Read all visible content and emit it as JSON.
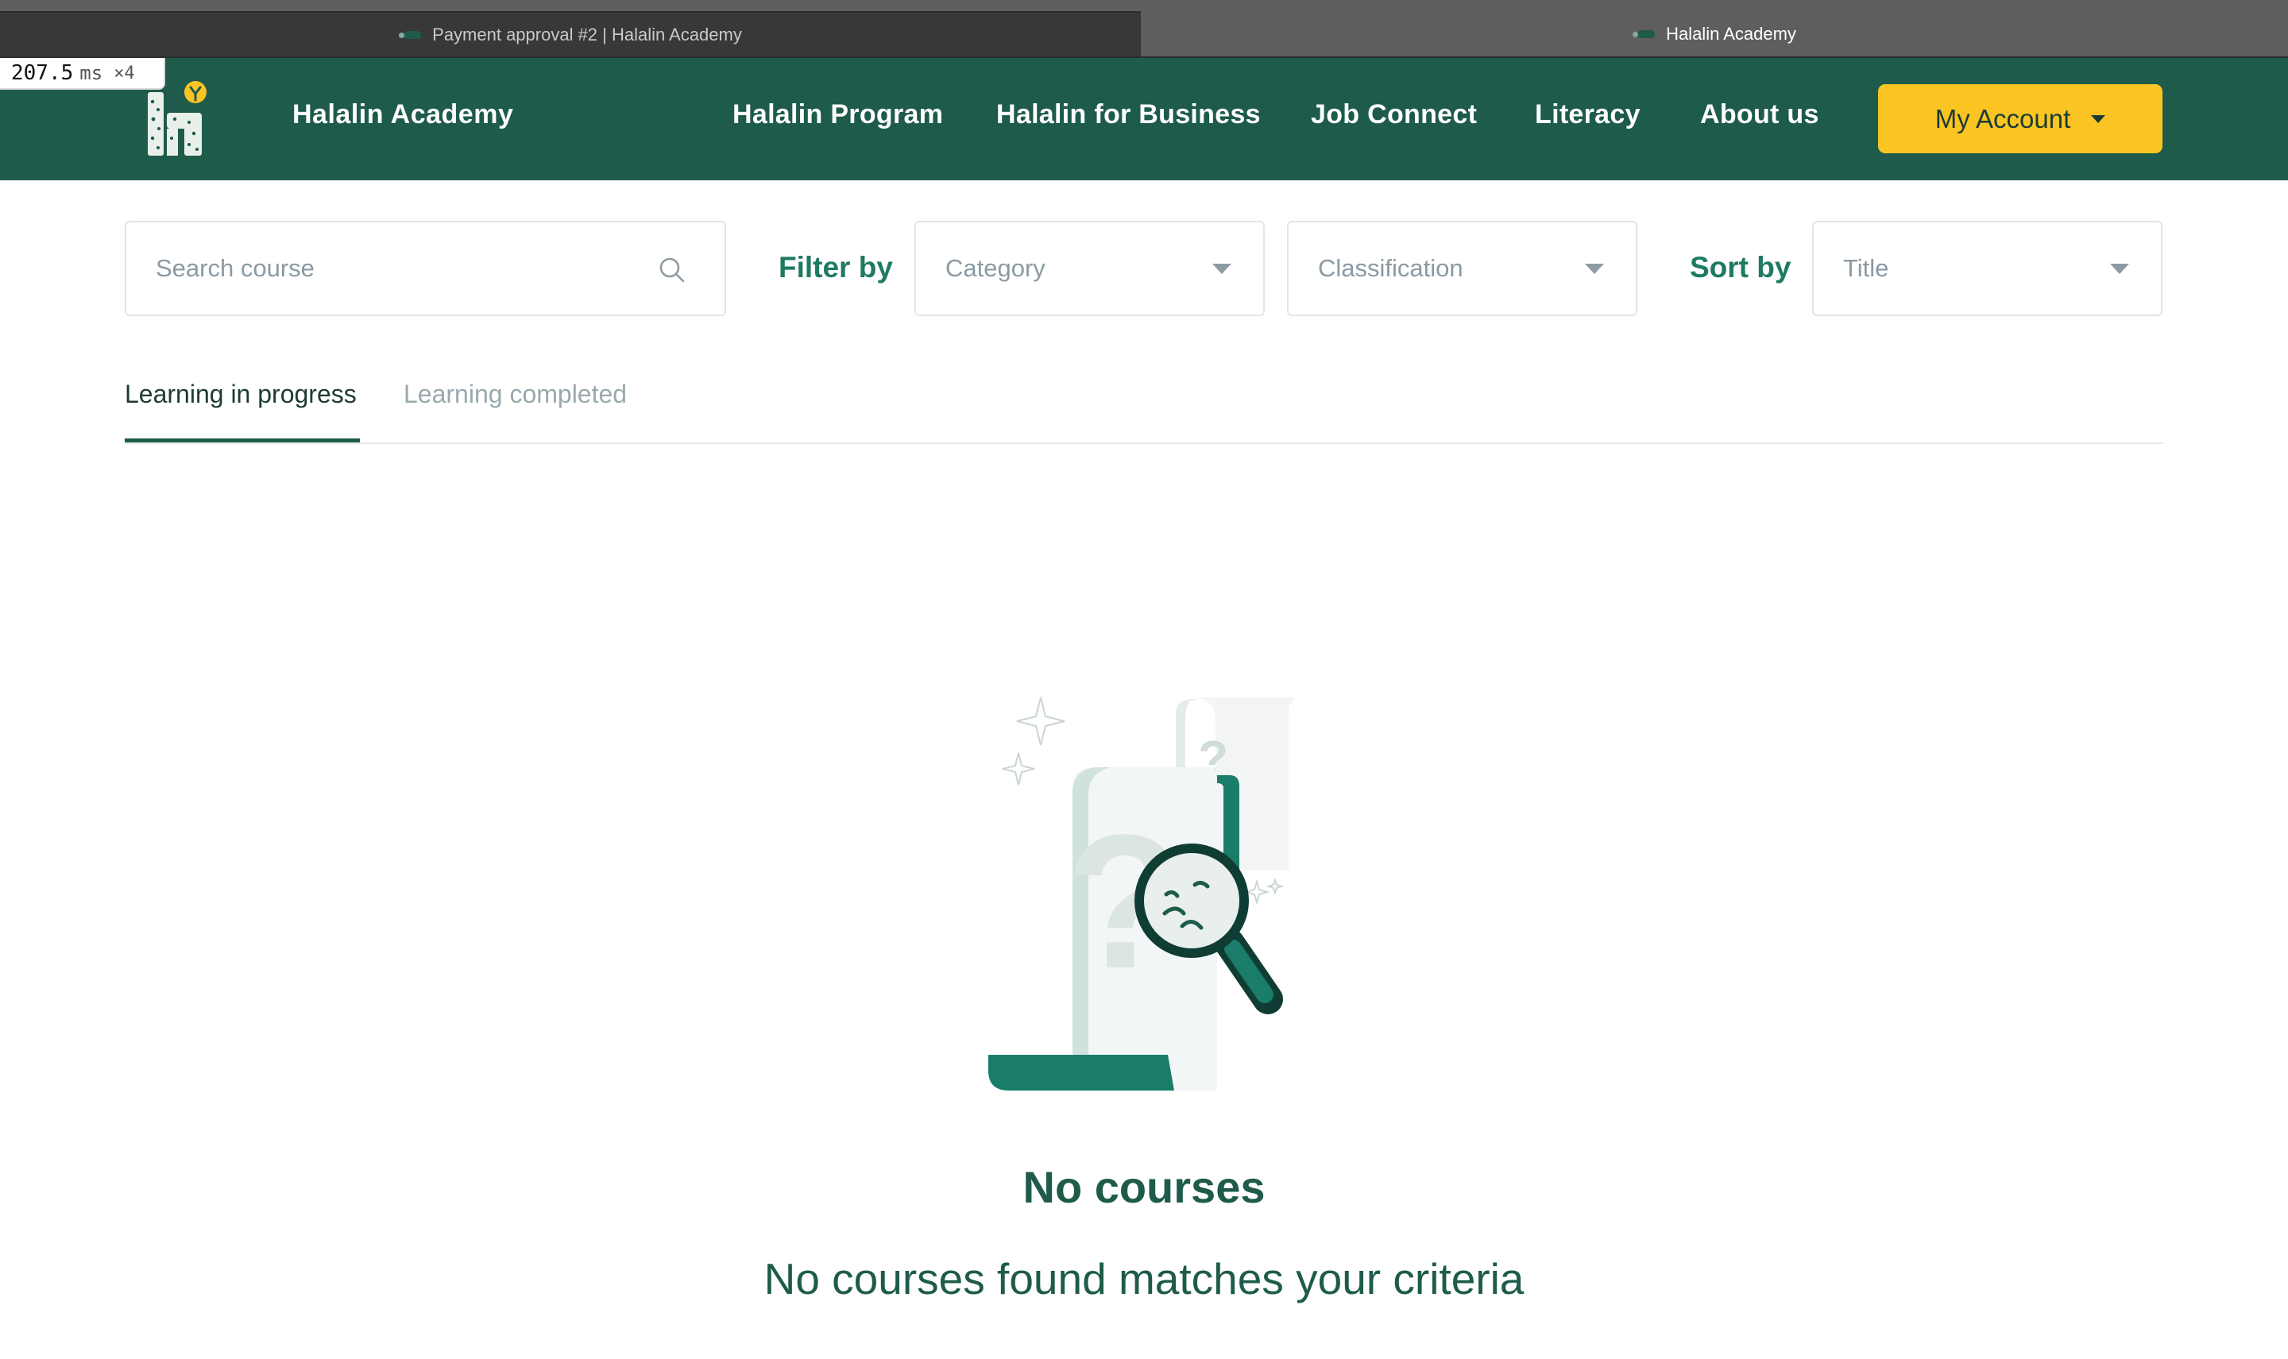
{
  "browser": {
    "tabs": [
      {
        "title": "Payment approval #2 | Halalin Academy",
        "active": false
      },
      {
        "title": "Halalin Academy",
        "active": true
      }
    ]
  },
  "timing": {
    "value": "207.5",
    "unit": "ms",
    "multiplier": "×4"
  },
  "header": {
    "brand": "Halalin Academy",
    "nav": [
      "Halalin Program",
      "Halalin for Business",
      "Job Connect",
      "Literacy",
      "About us"
    ],
    "account_label": "My Account",
    "colors": {
      "header_bg": "#1e5b4b",
      "account_bg": "#fac523"
    }
  },
  "filters": {
    "search_placeholder": "Search course",
    "filter_label": "Filter by",
    "category_placeholder": "Category",
    "classification_placeholder": "Classification",
    "sort_label": "Sort by",
    "sort_value": "Title"
  },
  "course_tabs": {
    "in_progress": "Learning in progress",
    "completed": "Learning completed",
    "active": "in_progress"
  },
  "empty_state": {
    "title": "No courses",
    "message": "No courses found matches your criteria",
    "icon": "magnifier-document-illustration"
  }
}
